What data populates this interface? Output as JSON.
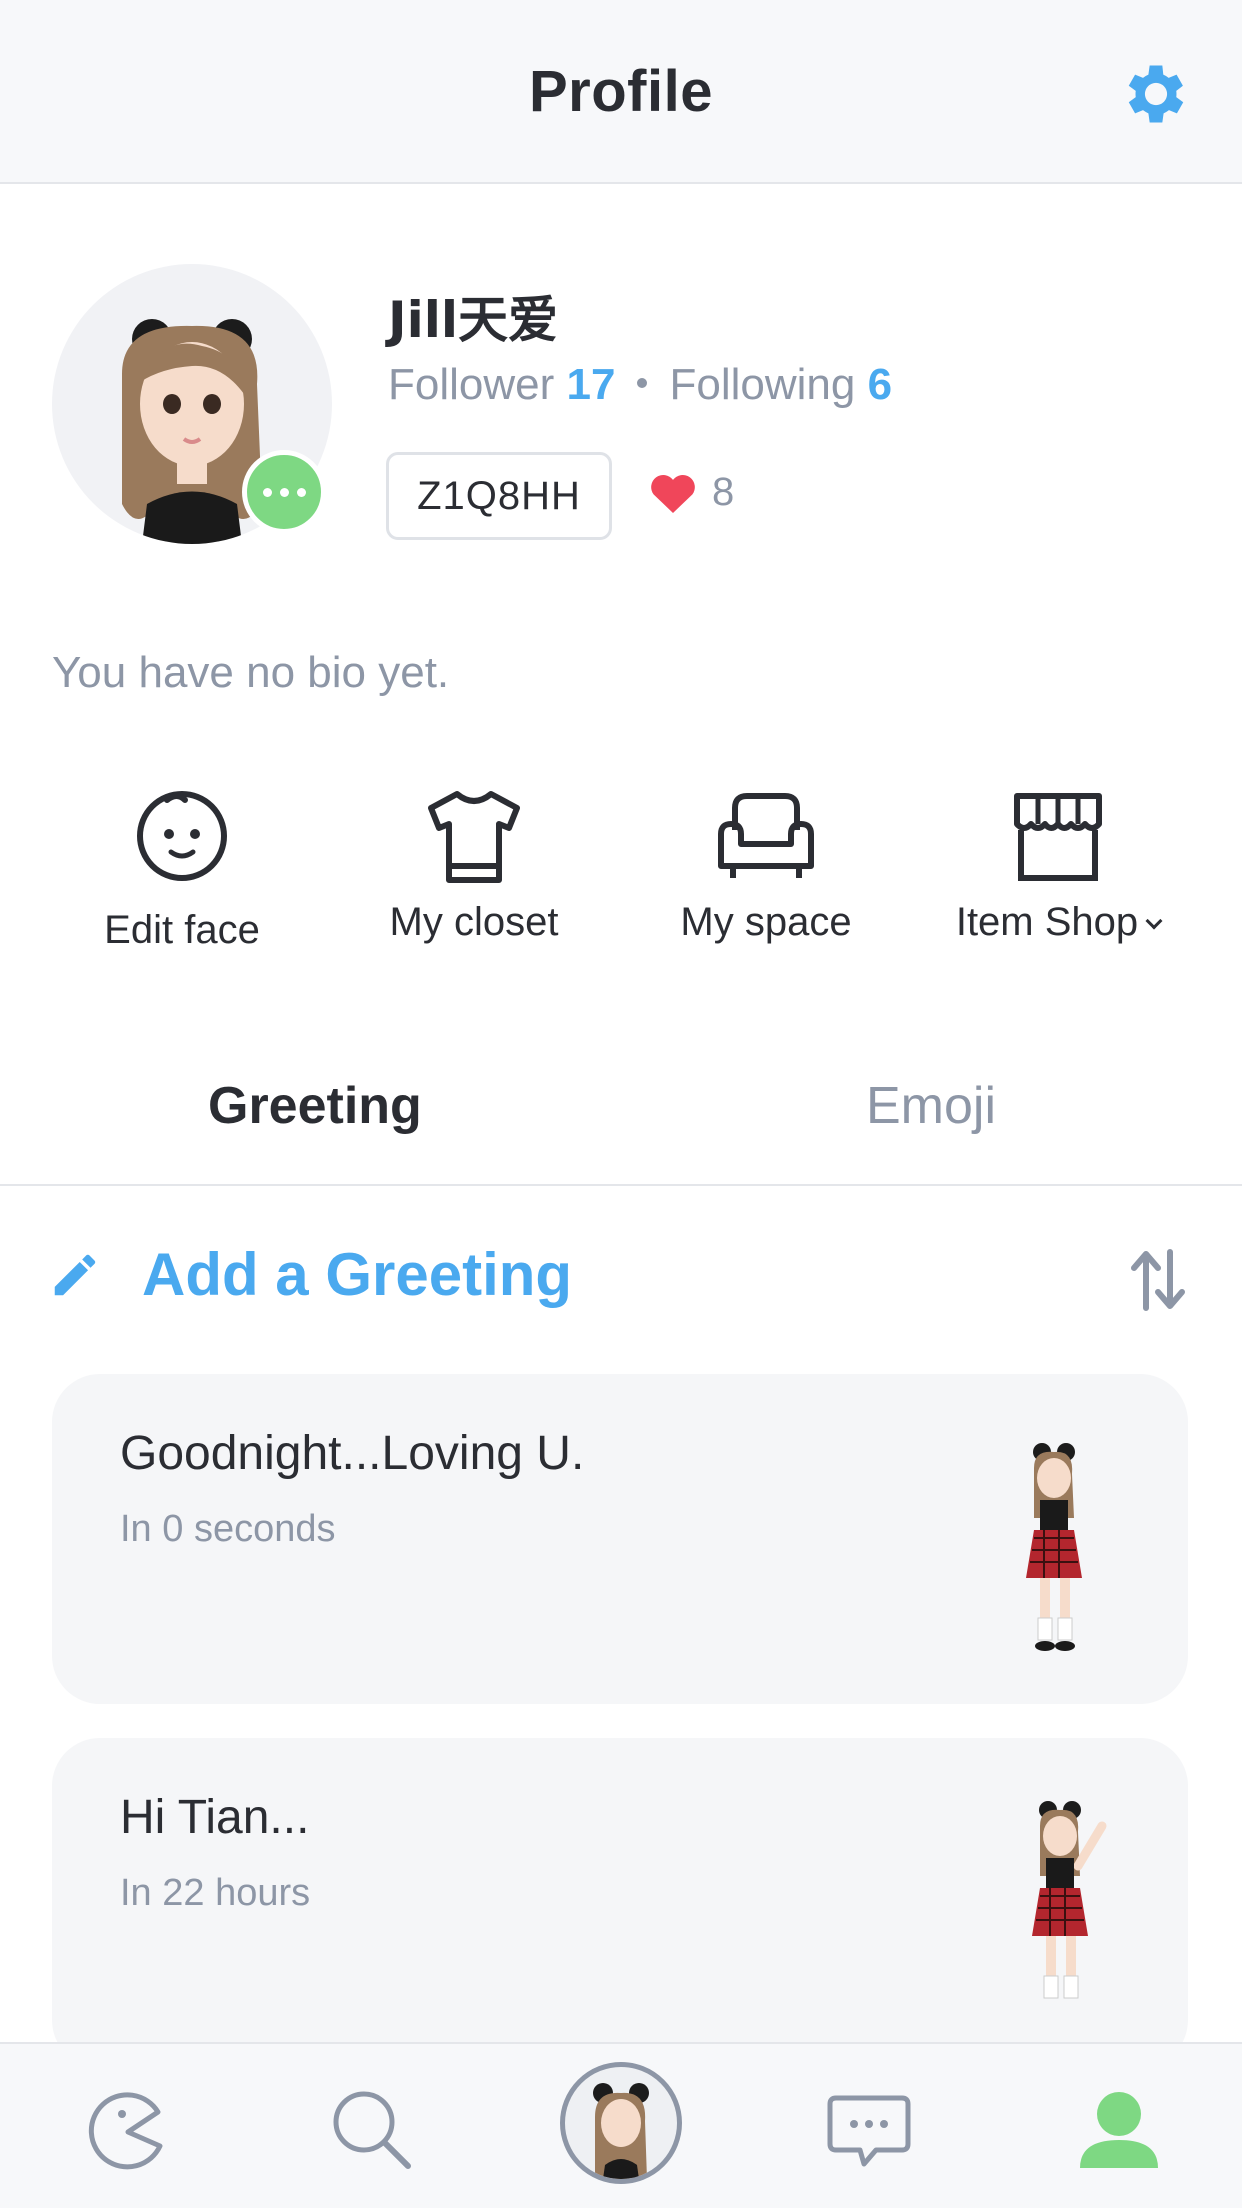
{
  "header": {
    "title": "Profile",
    "settings_icon": "gear-icon"
  },
  "profile": {
    "name": "Jill天爱",
    "follower_label": "Follower",
    "follower_count": "17",
    "following_label": "Following",
    "following_count": "6",
    "code": "Z1Q8HH",
    "likes": "8",
    "bio": "You have no bio yet."
  },
  "actions": [
    {
      "label": "Edit face",
      "icon": "face-icon"
    },
    {
      "label": "My closet",
      "icon": "shirt-icon"
    },
    {
      "label": "My space",
      "icon": "sofa-icon"
    },
    {
      "label": "Item Shop",
      "icon": "shop-icon"
    }
  ],
  "tabs": [
    {
      "label": "Greeting",
      "active": true
    },
    {
      "label": "Emoji",
      "active": false
    }
  ],
  "greeting": {
    "add_label": "Add a Greeting",
    "items": [
      {
        "title": "Goodnight...Loving U.",
        "time": "In 0 seconds"
      },
      {
        "title": "Hi Tian...",
        "time": "In 22 hours"
      }
    ]
  },
  "nav": [
    {
      "icon": "pacman-icon"
    },
    {
      "icon": "search-icon"
    },
    {
      "icon": "avatar-icon"
    },
    {
      "icon": "chat-icon"
    },
    {
      "icon": "profile-icon"
    }
  ],
  "colors": {
    "accent": "#4aa9ef",
    "green": "#7ed883",
    "heart": "#f0465a",
    "muted": "#8d96a6"
  }
}
